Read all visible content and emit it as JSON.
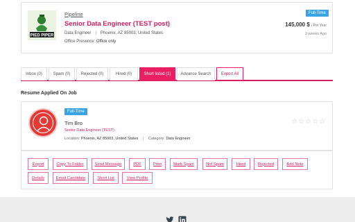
{
  "job": {
    "pipeline_label": "Pipeline",
    "title": "Senior Data Engineer (TEST post)",
    "department": "Data Engineer",
    "location": "Phoenix, AZ 85003, United States",
    "presence_label": "Office Presence:",
    "presence_value": "Office only",
    "employment_type": "Full-Time",
    "salary": "145,000 $",
    "salary_period": "/ Per Year",
    "posted": "2 weeks Ago",
    "logo_text": "PIED PIPER",
    "logo_icon": "pied-piper-logo"
  },
  "tabs": [
    {
      "label": "Inbox (0)"
    },
    {
      "label": "Spam (0)"
    },
    {
      "label": "Rejected (0)"
    },
    {
      "label": "Hired (0)"
    },
    {
      "label": "Short listed (1)",
      "active": true
    },
    {
      "label": "Advance Search"
    },
    {
      "label": "Export All"
    }
  ],
  "section_title": "Resume Applied On Job",
  "candidate": {
    "employment_type": "Full-Time",
    "name": "Tim Bro",
    "applied_job": "Senior Data Engineer (TEST)",
    "location_label": "Location:",
    "location_value": "Phoenix, AZ 85003, United States",
    "category_label": "Category:",
    "category_value": "Data Engineer",
    "rating": 0,
    "rating_max": 5,
    "avatar_icon": "user-avatar-icon"
  },
  "actions": {
    "row1": [
      "Export",
      "Copy To Folder",
      "Send Message",
      "PDF",
      "Print",
      "Mark Spam",
      "Not Spam",
      "Hired",
      "Rejected",
      "Add Note"
    ],
    "row2": [
      "Details",
      "Email Candidate",
      "Short List",
      "View Profile"
    ]
  },
  "footer": {
    "icons": [
      "twitter-icon",
      "linkedin-icon"
    ]
  },
  "colors": {
    "accent": "#e91e63",
    "badge": "#3aa3e3",
    "avatar": "#e53935"
  }
}
